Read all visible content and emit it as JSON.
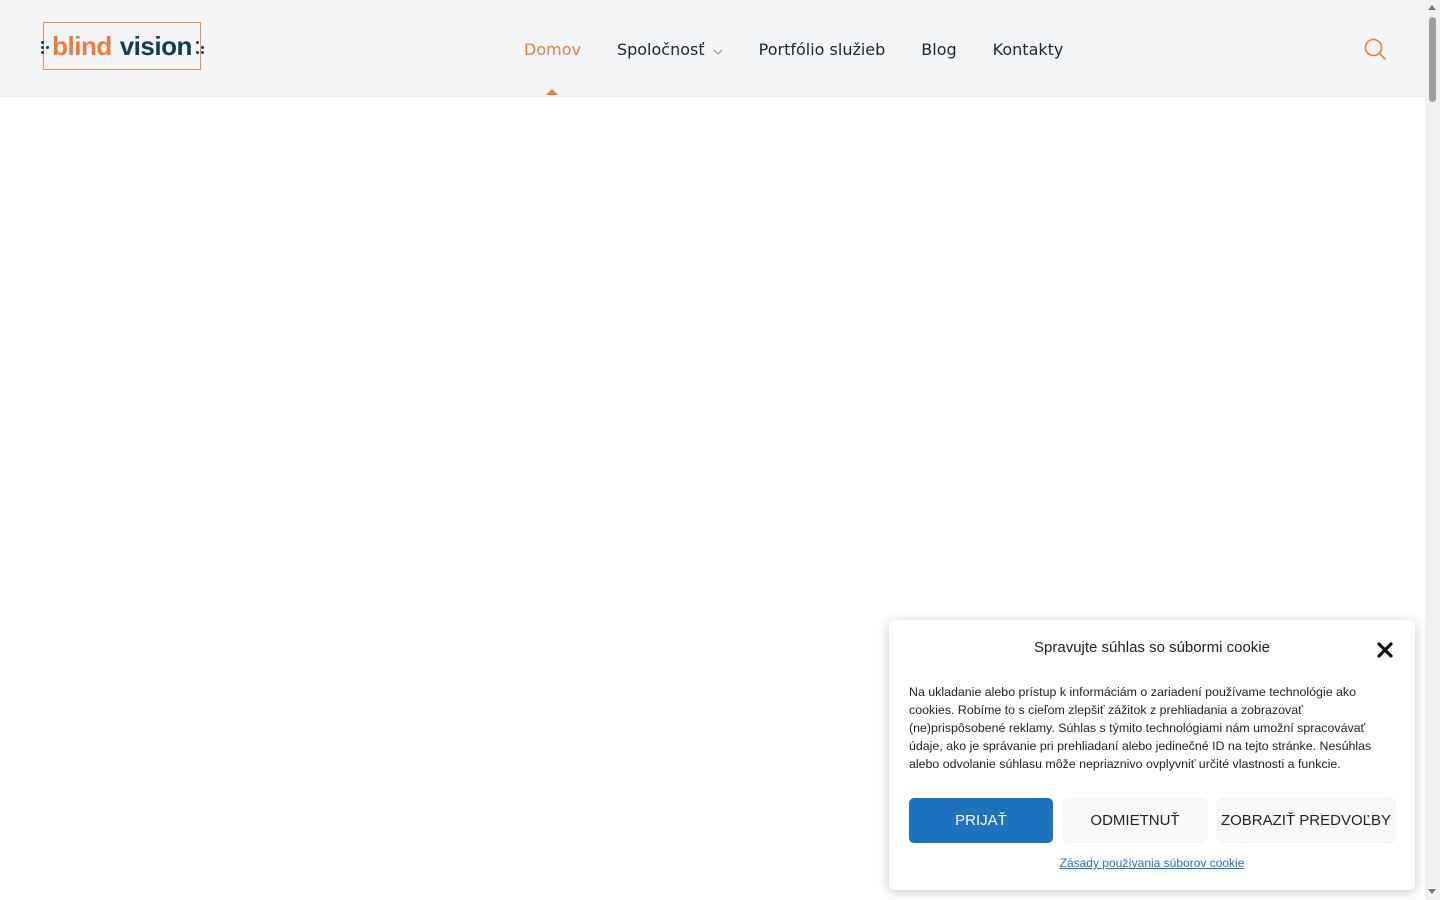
{
  "header": {
    "logo": {
      "word1": "blind",
      "word2": "vision"
    },
    "nav": [
      {
        "label": "Domov",
        "active": true
      },
      {
        "label": "Spoločnosť",
        "has_dropdown": true
      },
      {
        "label": "Portfólio služieb"
      },
      {
        "label": "Blog"
      },
      {
        "label": "Kontakty"
      }
    ],
    "search_icon": "search-icon"
  },
  "cookie_banner": {
    "title": "Spravujte súhlas so súbormi cookie",
    "text": "Na ukladanie alebo prístup k informáciám o zariadení používame technológie ako cookies. Robíme to s cieľom zlepšiť zážitok z prehliadania a zobrazovať (ne)prispôsobené reklamy. Súhlas s týmito technológiami nám umožní spracovávať údaje, ako je správanie pri prehliadaní alebo jedinečné ID na tejto stránke. Nesúhlas alebo odvolanie súhlasu môže nepriaznivo ovplyvniť určité vlastnosti a funkcie.",
    "accept_label": "PRIJAŤ",
    "deny_label": "ODMIETNUŤ",
    "prefs_label": "ZOBRAZIŤ PREDVOĽBY",
    "policy_link": "Zásady používania súborov cookie",
    "close_icon": "close-icon"
  },
  "colors": {
    "accent": "#f07a3c",
    "brand_dark": "#143d4e",
    "primary_button": "#1e73be",
    "header_bg": "#f3f5f7"
  }
}
